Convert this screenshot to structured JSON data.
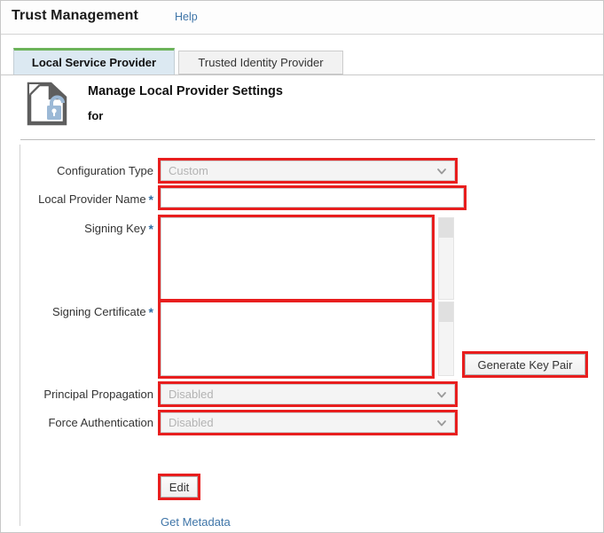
{
  "header": {
    "title": "Trust Management",
    "help_label": "Help"
  },
  "tabs": [
    {
      "label": "Local Service Provider",
      "active": true
    },
    {
      "label": "Trusted Identity Provider",
      "active": false
    }
  ],
  "heading": {
    "icon": "document-unlock-icon",
    "title": "Manage Local Provider Settings",
    "subtitle": "for"
  },
  "form": {
    "fields": [
      {
        "label": "Configuration Type",
        "required": false,
        "type": "select",
        "value": "Custom",
        "disabled": true
      },
      {
        "label": "Local Provider Name",
        "required": true,
        "type": "text",
        "value": "",
        "placeholder": ""
      },
      {
        "label": "Signing Key",
        "required": true,
        "type": "textarea",
        "value": "",
        "placeholder": ""
      },
      {
        "label": "Signing Certificate",
        "required": true,
        "type": "textarea",
        "value": "",
        "placeholder": ""
      },
      {
        "label": "Principal Propagation",
        "required": false,
        "type": "select",
        "value": "Disabled",
        "disabled": true
      },
      {
        "label": "Force Authentication",
        "required": false,
        "type": "select",
        "value": "Disabled",
        "disabled": true
      }
    ],
    "required_marker": "*",
    "dropdown_icon": "chevron-down-icon"
  },
  "buttons": {
    "generate_key_pair": "Generate Key Pair",
    "edit": "Edit"
  },
  "links": {
    "get_metadata": "Get Metadata"
  },
  "colors": {
    "annotation": "#e81e1e",
    "link": "#3f75a8",
    "required_star": "#2e6da4",
    "active_tab_bg": "#dce9f2",
    "active_tab_top": "#6cb35a",
    "lock_blue": "#9cb9d6"
  }
}
